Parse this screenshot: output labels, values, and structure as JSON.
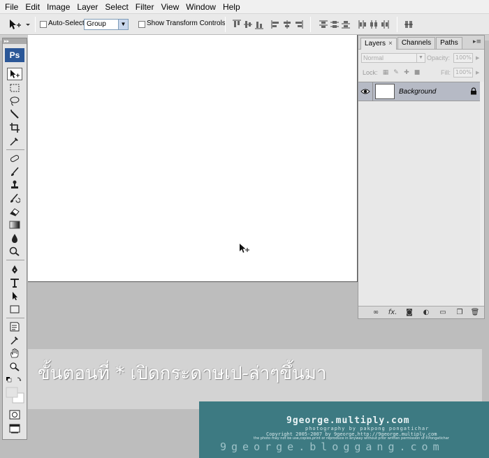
{
  "menu": [
    "File",
    "Edit",
    "Image",
    "Layer",
    "Select",
    "Filter",
    "View",
    "Window",
    "Help"
  ],
  "options_bar": {
    "auto_select_label": "Auto-Select:",
    "auto_select_value": "Group",
    "show_transform_label": "Show Transform Controls"
  },
  "tools_panel": {
    "logo": "Ps"
  },
  "layers_panel": {
    "tabs": [
      "Layers",
      "Channels",
      "Paths"
    ],
    "blend_mode": "Normal",
    "opacity_label": "Opacity:",
    "opacity_value": "100%",
    "lock_label": "Lock:",
    "fill_label": "Fill:",
    "fill_value": "100%",
    "layer_name": "Background"
  },
  "caption": {
    "text": "ขั้นตอนที่ * เปิดกระดาษเป-ล่าๆขึ้นมา"
  },
  "watermark": {
    "site": "9george.multiply.com",
    "credit": "photography by pakpong pongatichar",
    "copyright": "Copyright 2005-2007 by 9george,http://9george.multiply.com",
    "notice": "the photo may not be use,copies,print or reproduce in anyway without prior written permission of P.Pongatichar",
    "blog": "9george.bloggang.com"
  }
}
